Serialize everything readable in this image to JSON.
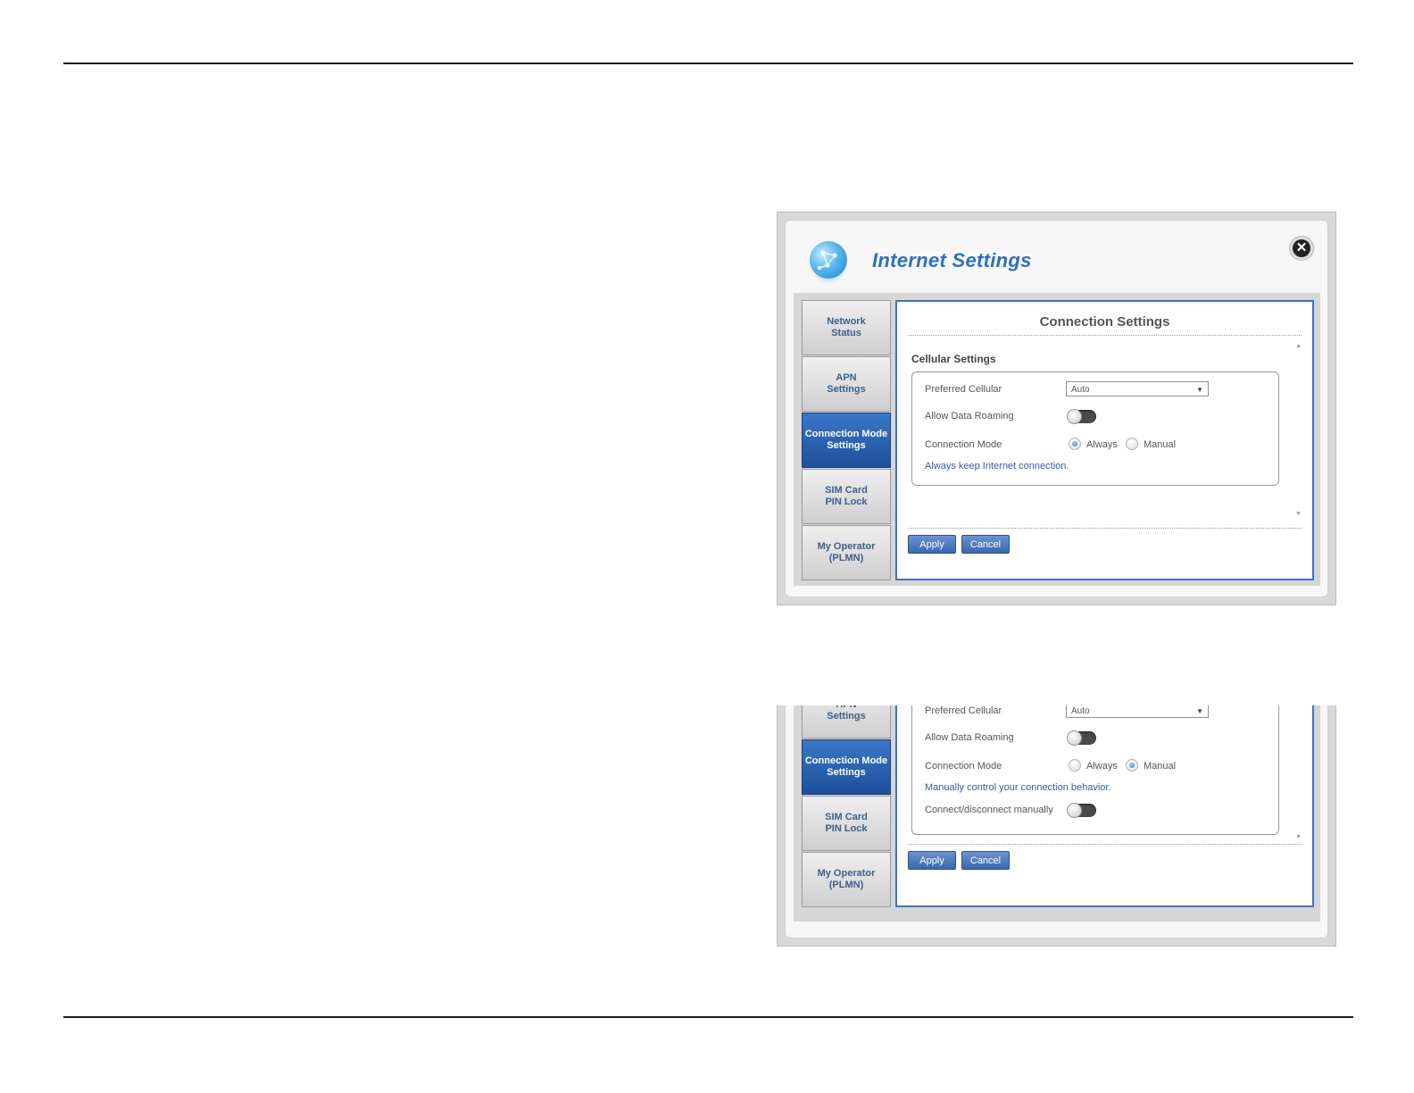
{
  "dialog": {
    "title": "Internet Settings",
    "close_symbol": "✕",
    "logo_icon": "globe-network-icon"
  },
  "sidebar": {
    "items": [
      {
        "label_1": "Network",
        "label_2": "Status"
      },
      {
        "label_1": "APN",
        "label_2": "Settings"
      },
      {
        "label_1": "Connection Mode",
        "label_2": "Settings"
      },
      {
        "label_1": "SIM Card",
        "label_2": "PIN Lock"
      },
      {
        "label_1": "My Operator",
        "label_2": "(PLMN)"
      }
    ],
    "active": "Connection Mode Settings"
  },
  "panel1": {
    "title": "Connection Settings",
    "section": "Cellular Settings",
    "preferred_label": "Preferred Cellular",
    "preferred_value": "Auto",
    "roaming_label": "Allow Data Roaming",
    "mode_label": "Connection Mode",
    "opt_always": "Always",
    "opt_manual": "Manual",
    "selected_mode": "Always",
    "hint": "Always keep Internet connection.",
    "apply": "Apply",
    "cancel": "Cancel"
  },
  "panel2": {
    "preferred_label": "Preferred Cellular",
    "preferred_value": "Auto",
    "roaming_label": "Allow Data Roaming",
    "mode_label": "Connection Mode",
    "opt_always": "Always",
    "opt_manual": "Manual",
    "selected_mode": "Manual",
    "hint": "Manually control your connection behavior.",
    "manual_label": "Connect/disconnect manually",
    "apply": "Apply",
    "cancel": "Cancel"
  },
  "colors": {
    "accent": "#2f6fb8",
    "active_tab": "#1d4f9b",
    "content_border": "#3d72c0"
  }
}
